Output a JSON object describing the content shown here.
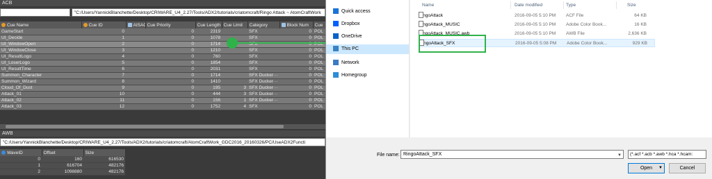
{
  "acb": {
    "header": "ACB",
    "path": "\"C:/Users/YannickBlanchette/Desktop/CRIWARE_U4_2.27/Tools/ADX2/tutorials/criatomcraft/Ringo Attack ~ AtomCraftWork",
    "columns": [
      "Cue Name",
      "Cue ID",
      "AISAC",
      "Cue Priority",
      "Cue Length",
      "Cue Limit",
      "Category",
      "Block Num",
      "Cue"
    ],
    "rows": [
      [
        "GameStart",
        "0",
        "",
        "0",
        "2319",
        "",
        "SFX",
        "0",
        "POL"
      ],
      [
        "UI_Decide",
        "1",
        "",
        "0",
        "1078",
        "",
        "SFX",
        "0",
        "POL"
      ],
      [
        "UI_WindowOpen",
        "2",
        "",
        "0",
        "1714",
        "",
        "SFX",
        "0",
        "POL"
      ],
      [
        "UI_WindowClose",
        "3",
        "",
        "0",
        "1210",
        "",
        "SFX",
        "0",
        "POL"
      ],
      [
        "UI_ResultLogo",
        "4",
        "",
        "0",
        "760",
        "",
        "SFX",
        "0",
        "POL"
      ],
      [
        "UI_LoserLogo",
        "5",
        "",
        "0",
        "1854",
        "",
        "SFX",
        "0",
        "POL"
      ],
      [
        "UI_ResultTime",
        "6",
        "",
        "0",
        "2031",
        "",
        "SFX",
        "0",
        "POL"
      ],
      [
        "Summon_Character",
        "7",
        "",
        "0",
        "1714",
        "",
        "SFX Ducker···",
        "0",
        "POL"
      ],
      [
        "Summon_Wizard",
        "8",
        "",
        "0",
        "1410",
        "",
        "SFX Ducker···",
        "0",
        "POL"
      ],
      [
        "Cloud_Of_Dust",
        "9",
        "",
        "0",
        "195",
        "3",
        "SFX Ducker···",
        "0",
        "POL"
      ],
      [
        "Attack_01",
        "10",
        "",
        "0",
        "444",
        "3",
        "SFX Ducker···",
        "0",
        "POL"
      ],
      [
        "Attack_02",
        "11",
        "",
        "0",
        "156",
        "1",
        "SFX Ducker···",
        "0",
        "POL"
      ],
      [
        "Attack_03",
        "12",
        "",
        "0",
        "1752",
        "4",
        "SFX",
        "0",
        "POL"
      ]
    ]
  },
  "awb": {
    "header": "AWB",
    "path": "\"C:/Users/YannickBlanchette/Desktop/CRIWARE_U4_2.27/Tools/ADX2/tutorials/criatomcraft/AtomCraftWork_GDC2016_20160326/PC/UseADX2Functi",
    "columns": [
      "WaveID",
      "Offset",
      "Size"
    ],
    "rows": [
      [
        "0",
        "160",
        "616530"
      ],
      [
        "1",
        "616704",
        "482176"
      ],
      [
        "2",
        "1098880",
        "482176"
      ]
    ]
  },
  "dialog": {
    "nav": [
      "Quick access",
      "Dropbox",
      "OneDrive",
      "This PC",
      "Network",
      "Homegroup"
    ],
    "nav_selected": "This PC",
    "columns": [
      "Name",
      "Date modified",
      "Type",
      "Size"
    ],
    "files": [
      {
        "name": "RingoAttack",
        "date": "2016-09-05 5:10 PM",
        "type": "ACF File",
        "size": "64 KB"
      },
      {
        "name": "RingoAttack_MUSIC",
        "date": "2016-09-05 5:10 PM",
        "type": "Adobe Color Book...",
        "size": "16 KB"
      },
      {
        "name": "RingoAttack_MUSIC.awb",
        "date": "2016-09-05 5:10 PM",
        "type": "AWB File",
        "size": "2,636 KB"
      },
      {
        "name": "RingoAttack_SFX",
        "date": "2016-09-05 5:08 PM",
        "type": "Adobe Color Book...",
        "size": "929 KB"
      }
    ],
    "file_name_label": "File name:",
    "file_name_value": "RingoAttack_SFX",
    "filter": "(*.acf *.acb *.awb *.hca *.hcam:",
    "open_label": "Open",
    "cancel_label": "Cancel"
  },
  "colors": {
    "callout": "#2fb24a",
    "nav_selected": "#cce8ff"
  }
}
